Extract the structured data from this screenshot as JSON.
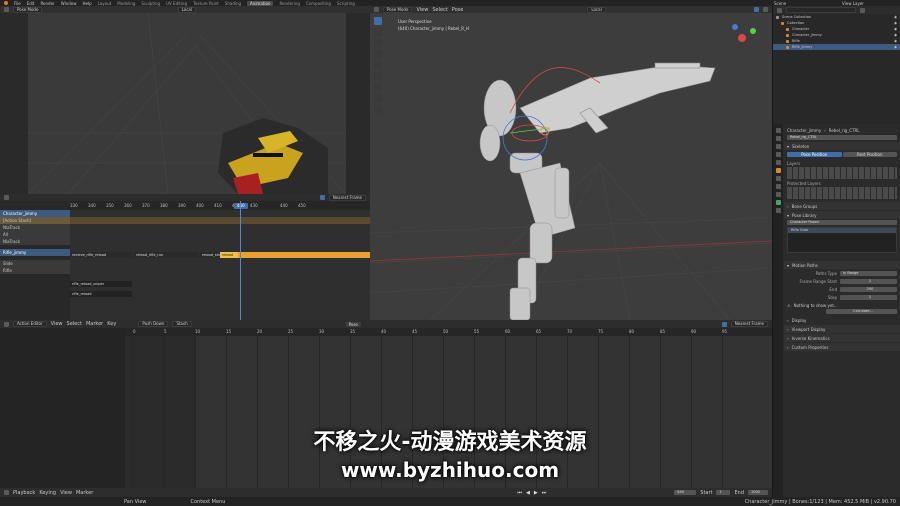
{
  "topbar": {
    "menus": [
      "File",
      "Edit",
      "Render",
      "Window",
      "Help"
    ],
    "tabs": [
      "Layout",
      "Modeling",
      "Sculpting",
      "UV Editing",
      "Texture Paint",
      "Shading",
      "Animation",
      "Rendering",
      "Compositing",
      "Scripting"
    ],
    "active_tab": "Animation",
    "scene_label": "Scene",
    "view_layer_label": "View Layer"
  },
  "camera_view": {
    "mode": "Pose Mode",
    "orientation": "Local"
  },
  "main_viewport": {
    "mode": "Pose Mode",
    "menus": [
      "View",
      "Select",
      "Pose"
    ],
    "orientation": "Local",
    "overlay_line1": "User Perspective",
    "overlay_line2": "(640) Character_jimmy | Rebel_R_H"
  },
  "nla_editor": {
    "frame_ticks": [
      "330",
      "340",
      "350",
      "360",
      "370",
      "380",
      "390",
      "400",
      "410",
      "420",
      "430",
      "440",
      "450"
    ],
    "current_frame": "440",
    "snap": "Nearest Frame",
    "tracks": [
      {
        "name": "Character_jimmy",
        "type": "object"
      },
      {
        "name": "[Action Stash]",
        "type": "stash"
      },
      {
        "name": "NlaTrack",
        "type": "track"
      },
      {
        "name": "All",
        "type": "track"
      },
      {
        "name": "NlaTrack",
        "type": "track"
      },
      {
        "name": "Rifle_jimmy",
        "type": "object"
      },
      {
        "name": "Slide",
        "type": "track"
      },
      {
        "name": "Rifle",
        "type": "track"
      }
    ],
    "strips": [
      {
        "label": "recieve_rifle_reload",
        "row": 4
      },
      {
        "label": "reload_rifle_run",
        "row": 4
      },
      {
        "label": "reload_stnd",
        "row": 4
      },
      {
        "label": "rifle_reload_sniper",
        "row": 6
      },
      {
        "label": "rifle_reload",
        "row": 7
      }
    ]
  },
  "action_editor": {
    "mode": "Action Editor",
    "menus": [
      "View",
      "Select",
      "Marker",
      "Key"
    ],
    "push_down": "Push Down",
    "stash": "Stash",
    "pose_btn": "Pose",
    "snap": "Nearest Frame",
    "frame_ticks": [
      "0",
      "5",
      "10",
      "15",
      "20",
      "25",
      "30",
      "35",
      "40",
      "45",
      "50",
      "55",
      "60",
      "65",
      "70",
      "75",
      "80",
      "85",
      "90",
      "95"
    ]
  },
  "timeline": {
    "menus": [
      "Playback",
      "Keying",
      "View",
      "Marker"
    ],
    "current_frame": "640",
    "start_label": "Start",
    "start_value": "1",
    "end_label": "End",
    "end_value": "1000"
  },
  "statusbar": {
    "left": "Pan View",
    "middle": "Context Menu",
    "right": "Character_jimmy | Bones:1/123 | Mem: 452.5 MiB | v2.90.70"
  },
  "outliner": {
    "title": "Scene Collection",
    "items": [
      {
        "name": "Scene Collection",
        "indent": 0,
        "selected": false
      },
      {
        "name": "Collection",
        "indent": 1,
        "selected": false
      },
      {
        "name": "Character",
        "indent": 2,
        "selected": false
      },
      {
        "name": "Character_jimmy",
        "indent": 2,
        "selected": false
      },
      {
        "name": "Rifle",
        "indent": 2,
        "selected": false
      },
      {
        "name": "Rifle_jimmy",
        "indent": 2,
        "selected": true
      }
    ]
  },
  "properties": {
    "object_name": "Character_jimmy",
    "armature_name": "Rebel_rig_CTRL",
    "data_field": "Rebel_rig_CTRL",
    "skeleton_header": "Skeleton",
    "pose_position": "Pose Position",
    "rest_position": "Rest Position",
    "layers_label": "Layers",
    "protected_layers_label": "Protected Layers",
    "bone_groups": "Bone Groups",
    "pose_library": "Pose Library",
    "pose_lib_name": "Character Posed",
    "pose_item": "Rifle Grab",
    "motion_paths": "Motion Paths",
    "paths_type_label": "Paths Type",
    "paths_type_value": "In Range",
    "frame_range_start_label": "Frame Range Start",
    "frame_range_start_value": "1",
    "end_label": "End",
    "end_value": "250",
    "step_label": "Step",
    "step_value": "1",
    "nothing_to_show": "Nothing to show yet...",
    "calculate": "Calculate...",
    "display": "Display",
    "viewport_display": "Viewport Display",
    "inverse_kinematics": "Inverse Kinematics",
    "custom_properties": "Custom Properties"
  },
  "watermark": {
    "line1": "不移之火-动漫游戏美术资源",
    "line2": "www.byzhihuo.com"
  },
  "colors": {
    "accent": "#3e6fa8",
    "playhead": "#4a8ad8",
    "strip_orange": "#e8a030",
    "strip_active": "#f0c040",
    "stash": "#6a5a3a"
  }
}
